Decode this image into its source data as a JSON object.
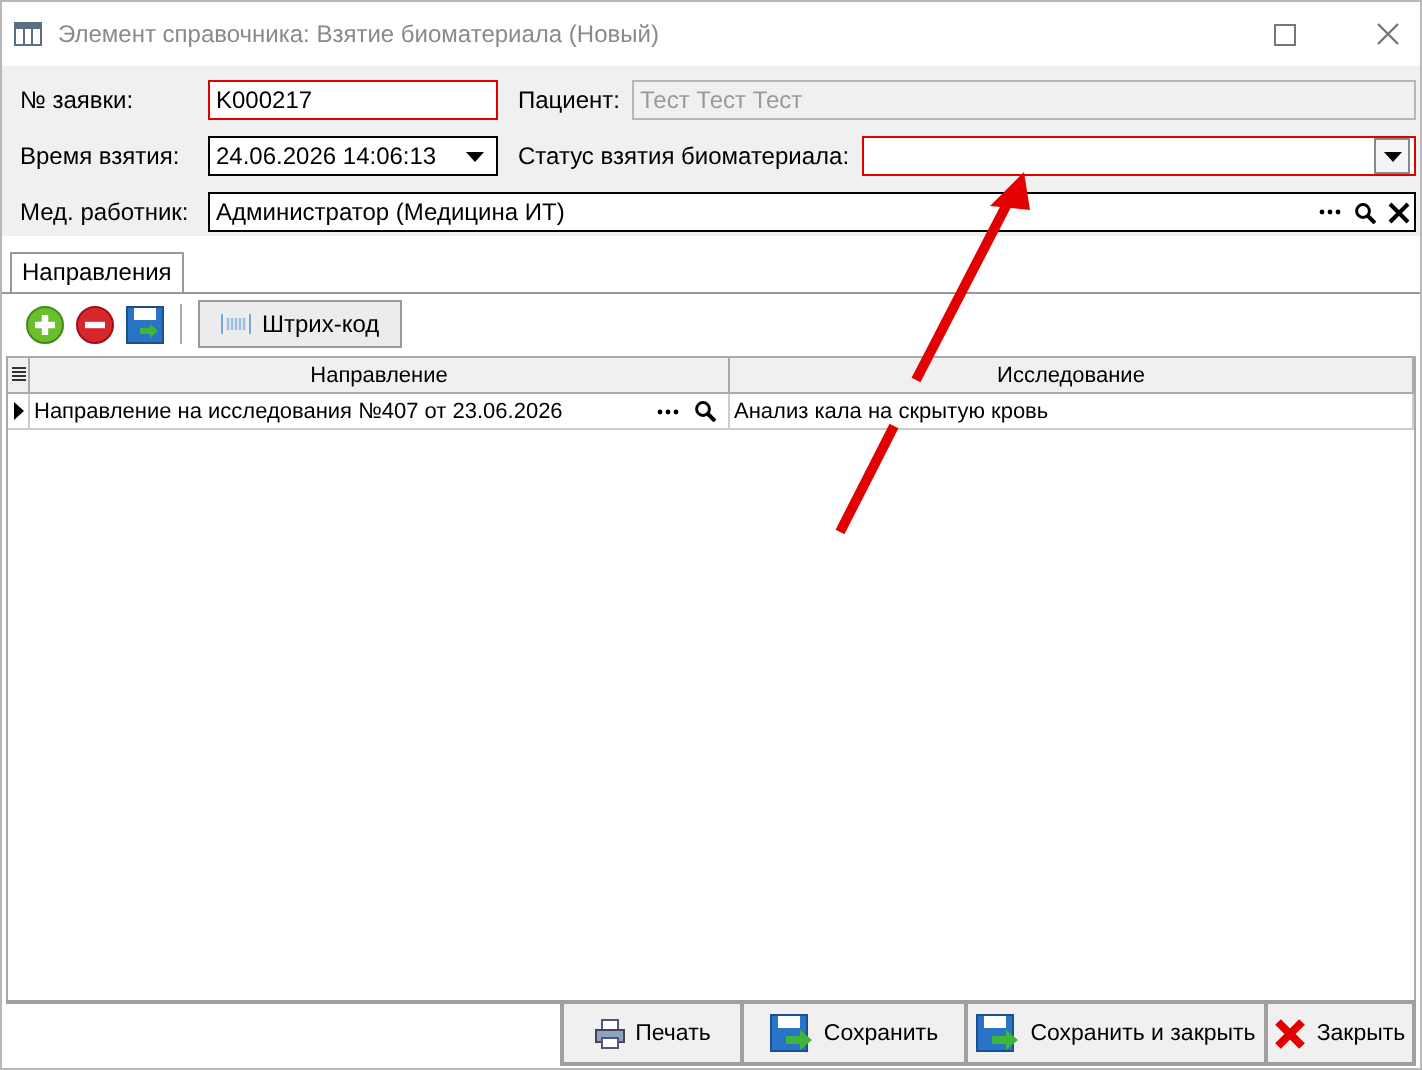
{
  "window": {
    "title": "Элемент справочника: Взятие биоматериала (Новый)"
  },
  "form": {
    "rows": [
      [
        {
          "label": "№ заявки:",
          "value": "K000217",
          "kind": "text",
          "invalid": true,
          "disabled": false
        },
        {
          "label": "Пациент:",
          "value": "Тест Тест Тест",
          "kind": "text",
          "invalid": false,
          "disabled": true
        }
      ],
      [
        {
          "label": "Время взятия:",
          "value": "24.06.2026 14:06:13",
          "kind": "dropdown",
          "invalid": false,
          "disabled": false
        },
        {
          "label": "Статус взятия биоматериала:",
          "kind": "dropdown",
          "invalid": true,
          "disabled": false
        }
      ],
      [
        {
          "label": "Мед. работник:",
          "value": "Администратор (Медицина ИТ)",
          "kind": "lookup",
          "invalid": false,
          "disabled": false
        }
      ]
    ]
  },
  "tabs": [
    {
      "label": "Направления",
      "selected": true
    }
  ],
  "toolbar": [
    {
      "kind": "add"
    },
    {
      "kind": "remove"
    },
    {
      "kind": "save"
    },
    {
      "kind": "barcode",
      "label": "Штрих-код"
    }
  ],
  "table": {
    "columns": [
      "Направление",
      "Исследование"
    ],
    "rows": [
      {
        "current": true,
        "cells": [
          "Направление на исследования №407 от 23.06.2026",
          "Анализ кала на скрытую кровь"
        ]
      }
    ]
  },
  "footer": [
    {
      "kind": "print",
      "label": "Печать"
    },
    {
      "kind": "save",
      "label": "Сохранить"
    },
    {
      "kind": "save",
      "label": "Сохранить и закрыть"
    },
    {
      "kind": "close",
      "label": "Закрыть"
    }
  ]
}
